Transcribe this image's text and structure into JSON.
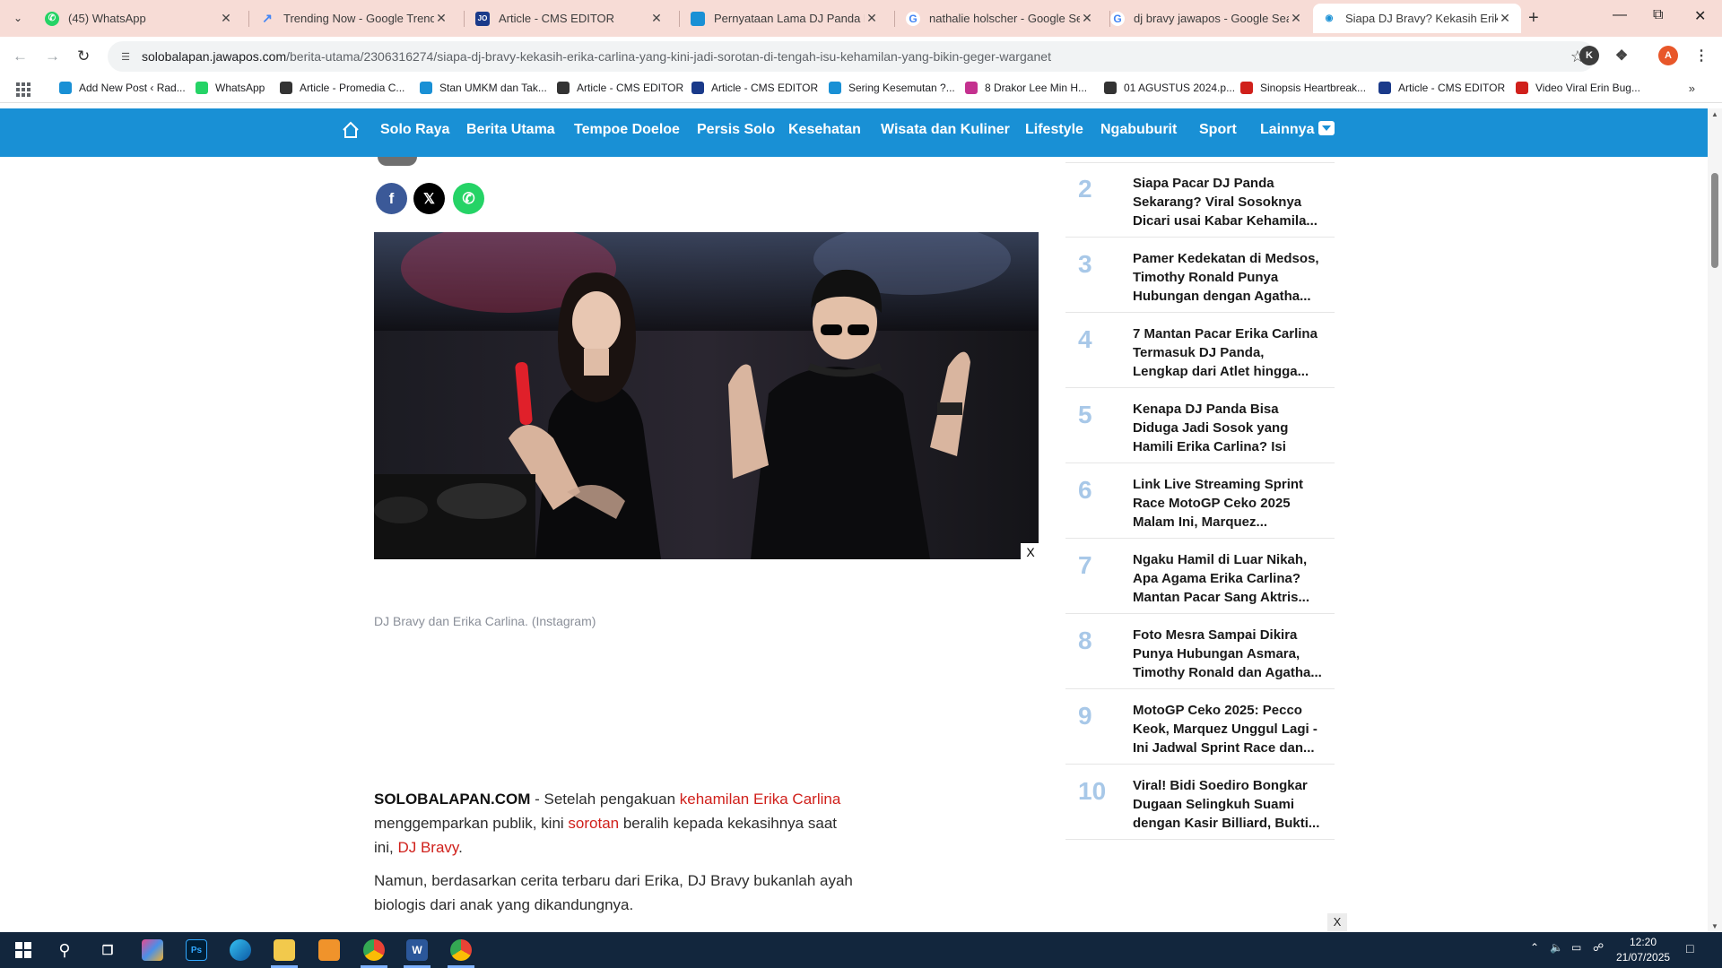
{
  "browser": {
    "tabs": [
      {
        "title": "(45) WhatsApp",
        "icon": "whatsapp-icon",
        "color": "#25d366"
      },
      {
        "title": "Trending Now - Google Trends",
        "icon": "trends-icon",
        "color": "#4285f4"
      },
      {
        "title": "Article - CMS EDITOR",
        "icon": "cms-icon",
        "color": "#1a3a8a"
      },
      {
        "title": "Pernyataan Lama DJ Panda Pun",
        "icon": "document-icon",
        "color": "#1990d5"
      },
      {
        "title": "nathalie holscher - Google Sear",
        "icon": "google-icon",
        "color": "#4285f4"
      },
      {
        "title": "dj bravy jawapos - Google Sear",
        "icon": "google-icon",
        "color": "#4285f4"
      },
      {
        "title": "Siapa DJ Bravy? Kekasih Erika C",
        "icon": "jawapos-icon",
        "color": "#1990d5"
      }
    ],
    "url_host": "solobalapan.jawapos.com",
    "url_path": "/berita-utama/2306316274/siapa-dj-bravy-kekasih-erika-carlina-yang-kini-jadi-sorotan-di-tengah-isu-kehamilan-yang-bikin-geger-warganet",
    "profile_initial": "A",
    "extension_initial": "K",
    "bookmarks": [
      {
        "label": "Add New Post ‹ Rad...",
        "color": "#1990d5"
      },
      {
        "label": "WhatsApp",
        "color": "#25d366"
      },
      {
        "label": "Article - Promedia C...",
        "color": "#333333"
      },
      {
        "label": "Stan UMKM dan Tak...",
        "color": "#1990d5"
      },
      {
        "label": "Article - CMS EDITOR",
        "color": "#333333"
      },
      {
        "label": "Article - CMS EDITOR",
        "color": "#1a3a8a"
      },
      {
        "label": "Sering Kesemutan ?...",
        "color": "#1990d5"
      },
      {
        "label": "8 Drakor Lee Min H...",
        "color": "#c4318f"
      },
      {
        "label": "01 AGUSTUS 2024.p...",
        "color": "#333333"
      },
      {
        "label": "Sinopsis Heartbreak...",
        "color": "#d0201b"
      },
      {
        "label": "Article - CMS EDITOR",
        "color": "#1a3a8a"
      },
      {
        "label": "Video Viral Erin Bug...",
        "color": "#d0201b"
      }
    ]
  },
  "site_nav": {
    "items": [
      "Solo Raya",
      "Berita Utama",
      "Tempoe Doeloe",
      "Persis Solo",
      "Kesehatan",
      "Wisata dan Kuliner",
      "Lifestyle",
      "Ngabuburit",
      "Sport",
      "Lainnya"
    ]
  },
  "article": {
    "caption": "DJ Bravy dan Erika Carlina. (Instagram)",
    "close_label": "X",
    "p1": {
      "brand": "SOLOBALAPAN.COM",
      "t1": " - Setelah pengakuan ",
      "l1": "kehamilan Erika Carlina",
      "t2": " menggemparkan publik, kini ",
      "l2": "sorotan",
      "t3": " beralih kepada kekasihnya saat ini, ",
      "l3": "DJ Bravy",
      "t4": "."
    },
    "p2": "Namun, berdasarkan cerita terbaru dari Erika, DJ Bravy bukanlah ayah biologis dari anak yang dikandungnya."
  },
  "popular": [
    {
      "num": "2",
      "title": "Siapa Pacar DJ Panda Sekarang? Viral Sosoknya Dicari usai Kabar Kehamila..."
    },
    {
      "num": "3",
      "title": "Pamer Kedekatan di Medsos, Timothy Ronald Punya Hubungan dengan Agatha..."
    },
    {
      "num": "4",
      "title": "7 Mantan Pacar Erika Carlina Termasuk DJ Panda, Lengkap dari Atlet hingga..."
    },
    {
      "num": "5",
      "title": "Kenapa DJ Panda Bisa Diduga Jadi Sosok yang Hamili Erika Carlina? Isi Cha..."
    },
    {
      "num": "6",
      "title": "Link Live Streaming Sprint Race MotoGP Ceko 2025 Malam Ini, Marquez..."
    },
    {
      "num": "7",
      "title": "Ngaku Hamil di Luar Nikah, Apa Agama Erika Carlina? Mantan Pacar Sang Aktris..."
    },
    {
      "num": "8",
      "title": "Foto Mesra Sampai Dikira Punya Hubungan Asmara, Timothy Ronald dan Agatha..."
    },
    {
      "num": "9",
      "title": "MotoGP Ceko 2025: Pecco Keok, Marquez Unggul Lagi - Ini Jadwal Sprint Race dan..."
    },
    {
      "num": "10",
      "title": "Viral! Bidi Soediro Bongkar Dugaan Selingkuh Suami dengan Kasir Billiard, Bukti..."
    }
  ],
  "sidebar_close_label": "X",
  "taskbar": {
    "time": "12:20",
    "date": "21/07/2025"
  },
  "colors": {
    "nav_bg": "#1990d5",
    "link_red": "#d0201b",
    "tab_strip": "#f7dcd6",
    "taskbar": "#12263d"
  }
}
